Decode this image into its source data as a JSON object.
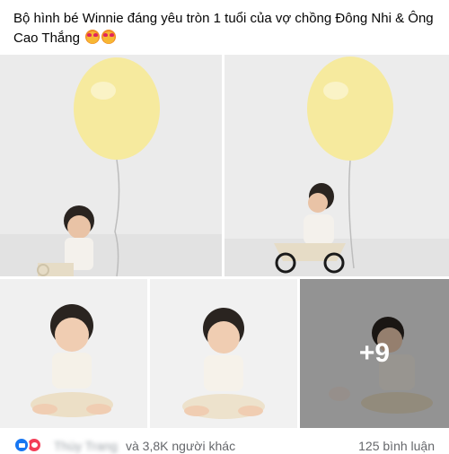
{
  "post": {
    "caption": "Bộ hình bé Winnie đáng yêu tròn 1 tuổi của vợ chồng Đông Nhi & Ông Cao Thắng",
    "emojis": [
      "smiling-face-with-hearts-icon",
      "smiling-face-with-hearts-icon"
    ]
  },
  "photos": {
    "more_count": "+9"
  },
  "reactions": {
    "icons": [
      "like-icon",
      "love-icon"
    ],
    "reactor_name": "Thùy Trang",
    "others_text": "và 3,8K người khác",
    "comments": "125 bình luận"
  },
  "colors": {
    "like": "#1877f2",
    "love": "#f33e58",
    "balloon": "#f6ea9e",
    "meta_text": "#65676b"
  }
}
